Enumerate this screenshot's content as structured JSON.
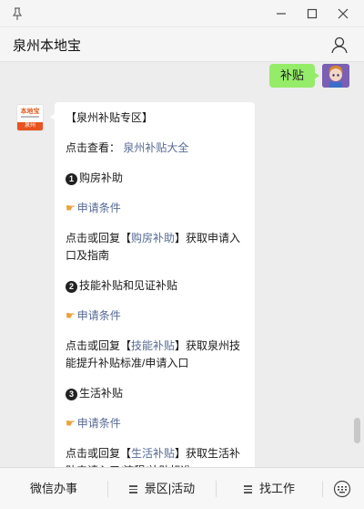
{
  "window": {
    "title": "泉州本地宝",
    "icons": [
      "pin-icon",
      "minimize-icon",
      "maximize-icon",
      "close-icon",
      "profile-icon"
    ]
  },
  "outgoing": {
    "text": "补贴"
  },
  "incoming": {
    "avatar": {
      "line1": "本地宝",
      "band": "泉州"
    },
    "heading": "【泉州补贴专区】",
    "intro_prefix": "点击查看：",
    "intro_link": "泉州补贴大全",
    "sections": [
      {
        "number": "1",
        "title": "购房补助",
        "condition_link": "申请条件",
        "desc_prefix": "点击或回复【",
        "keyword": "购房补助",
        "desc_suffix": "】获取申请入口及指南"
      },
      {
        "number": "2",
        "title": "技能补贴和见证补贴",
        "condition_link": "申请条件",
        "desc_prefix": "点击或回复【",
        "keyword": "技能补贴",
        "desc_suffix": "】获取泉州技能提升补贴标准/申请入口"
      },
      {
        "number": "3",
        "title": "生活补贴",
        "condition_link": "申请条件",
        "desc_prefix": "点击或回复【",
        "keyword": "生活补贴",
        "desc_suffix": "】获取生活补贴申请入口/流程/补贴标准"
      }
    ]
  },
  "menu": {
    "items": [
      "微信办事",
      "景区|活动",
      "找工作"
    ],
    "icons": [
      "menu-lines-icon",
      "keyboard-icon"
    ]
  },
  "colors": {
    "accent_link": "#576b95",
    "outgoing_bubble": "#95ec69",
    "brand": "#e8531f"
  }
}
